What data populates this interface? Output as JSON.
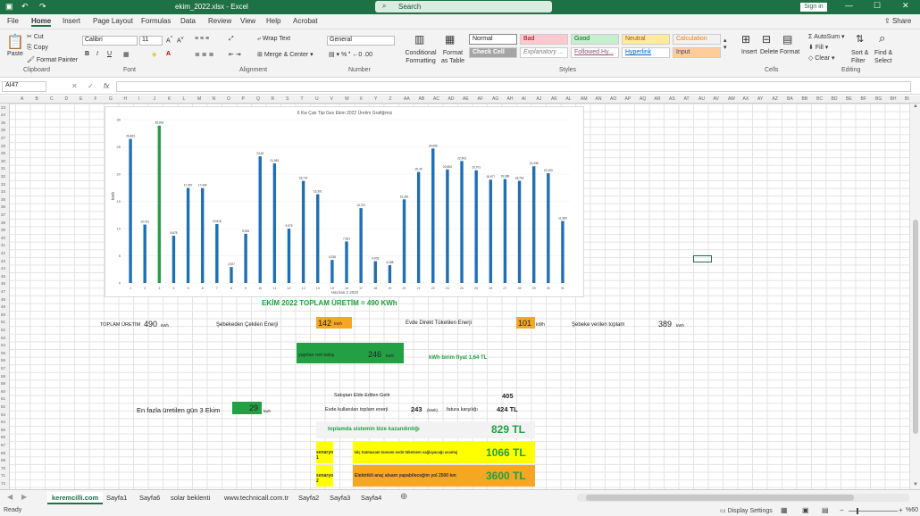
{
  "window": {
    "title": "ekim_2022.xlsx  -  Excel",
    "search": "Search",
    "signin": "Sign in"
  },
  "ribbon_tabs": [
    "File",
    "Home",
    "Insert",
    "Page Layout",
    "Formulas",
    "Data",
    "Review",
    "View",
    "Help",
    "Acrobat"
  ],
  "share": "Share",
  "clipboard": {
    "paste": "Paste",
    "cut": "Cut",
    "copy": "Copy",
    "format_painter": "Format Painter",
    "label": "Clipboard"
  },
  "font": {
    "name": "Calibri",
    "size": "11",
    "label": "Font"
  },
  "alignment": {
    "wrap": "Wrap Text",
    "merge": "Merge & Center",
    "label": "Alignment"
  },
  "number": {
    "format": "General",
    "label": "Number"
  },
  "styles": {
    "cond": "Conditional Formatting",
    "fmt_table": "Format as Table",
    "normal": "Normal",
    "bad": "Bad",
    "good": "Good",
    "neutral": "Neutral",
    "calc": "Calculation",
    "check": "Check Cell",
    "explan": "Explanatory ...",
    "followed": "Followed Hy...",
    "hyperlink": "Hyperlink",
    "input": "Input",
    "label": "Styles"
  },
  "cells": {
    "insert": "Insert",
    "delete": "Delete",
    "format": "Format",
    "label": "Cells"
  },
  "editing": {
    "autosum": "AutoSum",
    "fill": "Fill",
    "clear": "Clear",
    "sort": "Sort & Filter",
    "find": "Find & Select",
    "label": "Editing"
  },
  "formula_bar": {
    "namebox": "AI47",
    "fx": "fx",
    "value": ""
  },
  "columns": [
    "A",
    "B",
    "C",
    "D",
    "E",
    "F",
    "G",
    "H",
    "I",
    "J",
    "K",
    "L",
    "M",
    "N",
    "O",
    "P",
    "Q",
    "R",
    "S",
    "T",
    "U",
    "V",
    "W",
    "X",
    "Y",
    "Z",
    "AA",
    "AB",
    "AC",
    "AD",
    "AE",
    "AF",
    "AG",
    "AH",
    "AI",
    "AJ",
    "AK",
    "AL",
    "AM",
    "AN",
    "AO",
    "AP",
    "AQ",
    "AR",
    "AS",
    "AT",
    "AU",
    "AV",
    "AW",
    "AX",
    "AY",
    "AZ",
    "BA",
    "BB",
    "BC",
    "BD",
    "BE",
    "BF",
    "BG",
    "BH",
    "BI"
  ],
  "rows": [
    "23",
    "24",
    "25",
    "26",
    "27",
    "28",
    "29",
    "30",
    "31",
    "32",
    "33",
    "34",
    "35",
    "36",
    "37",
    "38",
    "39",
    "40",
    "41",
    "42",
    "43",
    "44",
    "45",
    "46",
    "47",
    "48",
    "49",
    "50",
    "51",
    "52",
    "53",
    "54",
    "55",
    "56",
    "57",
    "58",
    "59",
    "60",
    "61",
    "62",
    "63",
    "64",
    "65",
    "66",
    "67",
    "68",
    "69",
    "70",
    "71",
    "72"
  ],
  "chart_data": {
    "type": "bar",
    "title": "6 Kw Çatı Tipi Ges Ekim 2022 Üretim Grafiğimiz",
    "xlabel": "Haziran 2 2022",
    "ylabel": "kWh",
    "categories": [
      "1",
      "2",
      "3",
      "4",
      "5",
      "6",
      "7",
      "8",
      "9",
      "10",
      "11",
      "12",
      "13",
      "14",
      "15",
      "16",
      "17",
      "18",
      "19",
      "20",
      "21",
      "22",
      "23",
      "24",
      "25",
      "26",
      "27",
      "28",
      "29",
      "30",
      "31"
    ],
    "values": [
      26.463,
      10.731,
      28.903,
      8.678,
      17.457,
      17.434,
      10.818,
      2.927,
      9.034,
      23.26,
      21.963,
      9.975,
      18.747,
      16.301,
      4.236,
      7.631,
      13.751,
      4.003,
      3.268,
      15.361,
      20.39,
      24.699,
      20.854,
      22.403,
      20.701,
      18.977,
      19.086,
      18.762,
      21.438,
      20.153,
      11.389
    ],
    "value_labels": [
      "26,463",
      "10,731",
      "28,903",
      "8,678",
      "17,457",
      "17,434",
      "10,818",
      "2,927",
      "9,034",
      "23,26",
      "21,963",
      "9,975",
      "18,747",
      "16,301",
      "4,236",
      "7,631",
      "13,751",
      "4,003",
      "3,268",
      "15,361",
      "20,39",
      "24,699",
      "20,854",
      "22,403",
      "20,701",
      "18,977",
      "19,086",
      "18,762",
      "21,438",
      "20,153",
      "11,389"
    ],
    "highlight_index": 2,
    "highlight_color": "#22a043",
    "bar_color": "#1f6fb4",
    "ylim": [
      0,
      30
    ],
    "yticks": [
      "0",
      "5",
      "10",
      "15",
      "20",
      "25",
      "30"
    ]
  },
  "summary": {
    "headline": "EKİM 2022 TOPLAM ÜRETİM = 490 KWh",
    "toplam_label": "TOPLAM ÜRETİM",
    "toplam_val": "490",
    "kwh": "kWh",
    "sebekeden_label": "Şebekeden Çekilen Enerji",
    "sebekeden_val": "142",
    "sebekeden_unit": "kWh",
    "direkt_label": "Evde Direkt Tüketilen Enerji",
    "direkt_val": "101",
    "direkt_unit": "kWh",
    "verilen_label": "Şebeke verilen toplam",
    "verilen_val": "389",
    "verilen_unit": "kWh",
    "net_label": "yapılan net satış",
    "net_val": "246",
    "net_unit": "kWh",
    "fiyat": "kWh birim fiyat 1,64 TL",
    "gelir_label": "Satıştan Elde Edilen Gelir",
    "gelir_val": "405",
    "max_label": "En fazla üretilen gün 3 Ekim",
    "max_val": "29",
    "max_unit": "kwh",
    "evde_label": "Evde kullanılan toplam enerji",
    "evde_val": "243",
    "evde_unit": "(kWh)",
    "fatura_label": "fatura karşılığı",
    "fatura_val": "424 TL",
    "kazanc_label": "toplamda sistemin bize kazandırdığı",
    "kazanc_val": "829 TL",
    "s1_label": "senaryo 1",
    "s1_desc": "Hiç Satmasam tamamı evde tüketsem sağlayacağı avantaj",
    "s1_val": "1066 TL",
    "s2_label": "senaryo 2",
    "s2_desc": "Elektrikli araç alsam yapabileceğim yol  2500 km",
    "s2_val": "3600 TL"
  },
  "sheets": [
    "keremcilli.com",
    "Sayfa1",
    "Sayfa6",
    "solar beklenti",
    "www.technicall.com.tr",
    "Sayfa2",
    "Sayfa3",
    "Sayfa4"
  ],
  "active_sheet": 0,
  "status": {
    "ready": "Ready",
    "display": "Display Settings",
    "zoom": "%60"
  }
}
